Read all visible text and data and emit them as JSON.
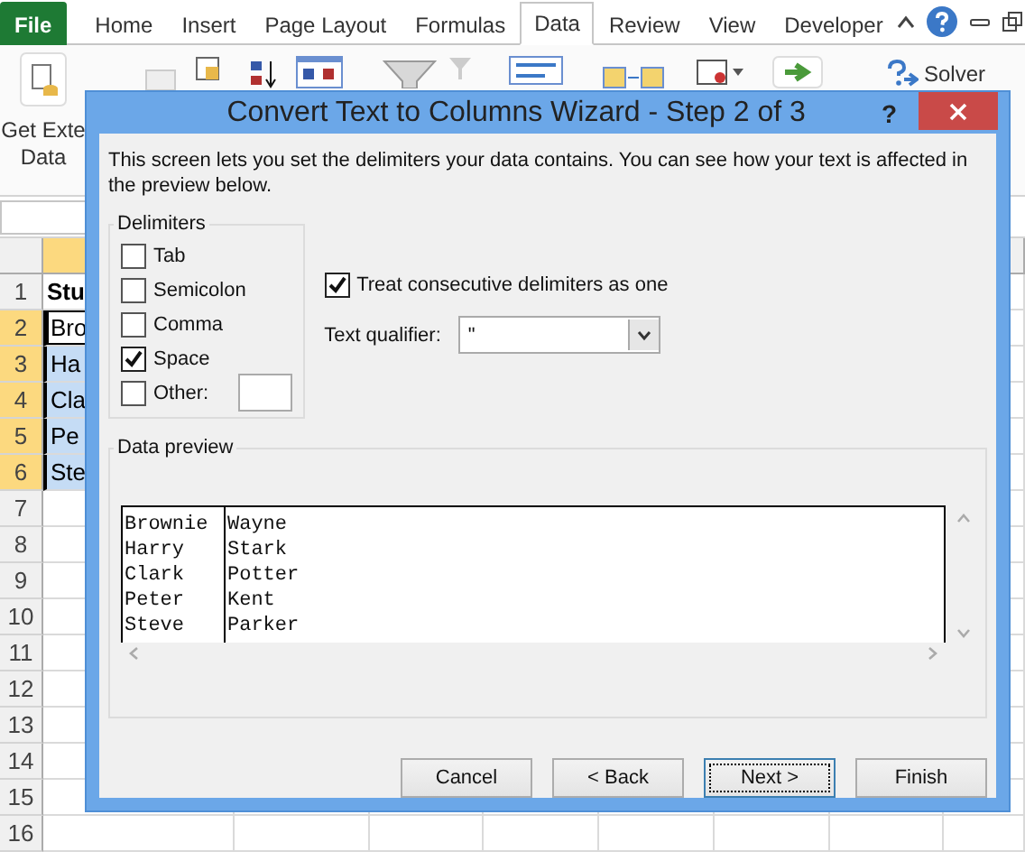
{
  "ribbon": {
    "tabs": [
      {
        "label": "File",
        "kind": "file",
        "selected": false
      },
      {
        "label": "Home",
        "kind": "tab",
        "selected": false
      },
      {
        "label": "Insert",
        "kind": "tab",
        "selected": false
      },
      {
        "label": "Page Layout",
        "kind": "tab",
        "selected": false
      },
      {
        "label": "Formulas",
        "kind": "tab",
        "selected": false
      },
      {
        "label": "Data",
        "kind": "tab",
        "selected": true
      },
      {
        "label": "Review",
        "kind": "tab",
        "selected": false
      },
      {
        "label": "View",
        "kind": "tab",
        "selected": false
      },
      {
        "label": "Developer",
        "kind": "tab",
        "selected": false
      }
    ],
    "get_data_label": [
      "Get Exte",
      "Data"
    ],
    "solver_label": "Solver"
  },
  "sheet": {
    "column_a_selected": true,
    "row_headers": [
      {
        "number": "1",
        "selected": false
      },
      {
        "number": "2",
        "selected": true
      },
      {
        "number": "3",
        "selected": true
      },
      {
        "number": "4",
        "selected": true
      },
      {
        "number": "5",
        "selected": true
      },
      {
        "number": "6",
        "selected": true
      },
      {
        "number": "7",
        "selected": false
      },
      {
        "number": "8",
        "selected": false
      },
      {
        "number": "9",
        "selected": false
      },
      {
        "number": "10",
        "selected": false
      },
      {
        "number": "11",
        "selected": false
      },
      {
        "number": "12",
        "selected": false
      },
      {
        "number": "13",
        "selected": false
      },
      {
        "number": "14",
        "selected": false
      },
      {
        "number": "15",
        "selected": false
      },
      {
        "number": "16",
        "selected": false
      }
    ],
    "column_a_cells": [
      {
        "text": "Stu",
        "bold": true,
        "selected": false,
        "active": false
      },
      {
        "text": "Bro",
        "bold": false,
        "selected": true,
        "active": true
      },
      {
        "text": "Ha",
        "bold": false,
        "selected": true,
        "active": false
      },
      {
        "text": "Cla",
        "bold": false,
        "selected": true,
        "active": false
      },
      {
        "text": "Pe",
        "bold": false,
        "selected": true,
        "active": false
      },
      {
        "text": "Ste",
        "bold": false,
        "selected": true,
        "active": false
      }
    ]
  },
  "dialog": {
    "title": "Convert Text to Columns Wizard - Step 2 of 3",
    "help": "?",
    "intro": "This screen lets you set the delimiters your data contains.  You can see how your text is affected in the preview below.",
    "delimiters": {
      "title": "Delimiters",
      "options": [
        {
          "label": "Tab",
          "checked": false,
          "kind": "plain"
        },
        {
          "label": "Semicolon",
          "checked": false,
          "kind": "plain"
        },
        {
          "label": "Comma",
          "checked": false,
          "kind": "plain"
        },
        {
          "label": "Space",
          "checked": true,
          "kind": "plain"
        },
        {
          "label": "Other:",
          "checked": false,
          "kind": "other"
        }
      ]
    },
    "treat_consecutive": {
      "label": "Treat consecutive delimiters as one",
      "checked": true
    },
    "text_qualifier": {
      "label": "Text qualifier:",
      "value": "\""
    },
    "preview": {
      "title": "Data preview",
      "rows": [
        [
          "Brownie",
          "Wayne"
        ],
        [
          "Harry",
          "Stark"
        ],
        [
          "Clark",
          "Potter"
        ],
        [
          "Peter",
          "Kent"
        ],
        [
          "Steve",
          "Parker"
        ]
      ]
    },
    "buttons": [
      {
        "label": "Cancel",
        "focused": false
      },
      {
        "label": "< Back",
        "focused": false
      },
      {
        "label": "Next >",
        "focused": true
      },
      {
        "label": "Finish",
        "focused": false
      }
    ]
  }
}
